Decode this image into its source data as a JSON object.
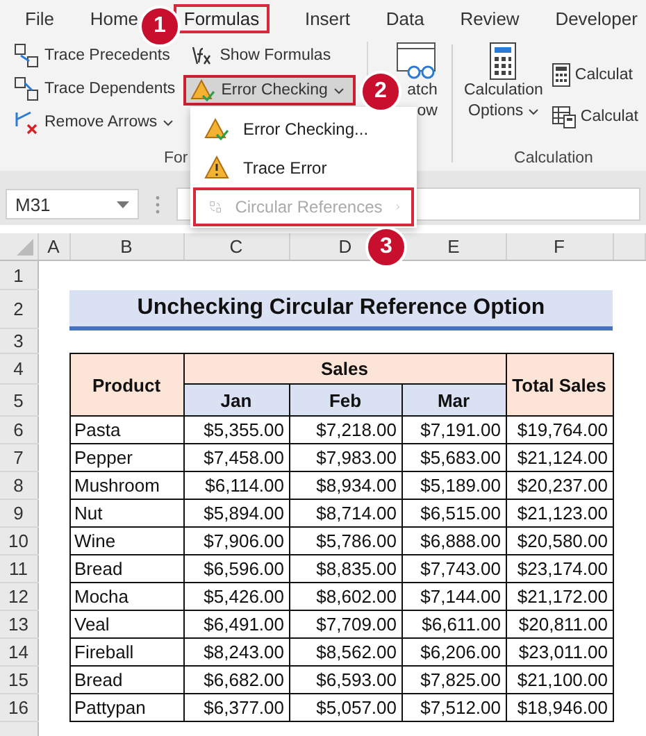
{
  "ribbon_tabs": [
    {
      "label": "File",
      "selected": false
    },
    {
      "label": "Home",
      "selected": false
    },
    {
      "label": "Formulas",
      "selected": true
    },
    {
      "label": "Insert",
      "selected": false
    },
    {
      "label": "Data",
      "selected": false
    },
    {
      "label": "Review",
      "selected": false
    },
    {
      "label": "Developer",
      "selected": false
    }
  ],
  "auditing": {
    "label": "For",
    "commands": [
      {
        "kind": "trace-precedents",
        "label": "Trace Precedents",
        "dropdown": false,
        "highlighted": false
      },
      {
        "kind": "trace-dependents",
        "label": "Trace Dependents",
        "dropdown": false,
        "highlighted": false
      },
      {
        "kind": "remove-arrows",
        "label": "Remove Arrows",
        "dropdown": true,
        "highlighted": false
      },
      {
        "kind": "show-formulas",
        "label": "Show Formulas",
        "dropdown": false,
        "highlighted": false
      },
      {
        "kind": "error-checking",
        "label": "Error Checking",
        "dropdown": true,
        "highlighted": true
      }
    ],
    "watch_lines": [
      "atch",
      "ow"
    ]
  },
  "calculation": {
    "label": "Calculation",
    "options_lines": [
      "Calculation",
      "Options"
    ],
    "commands": [
      "Calculat",
      "Calculat"
    ]
  },
  "error_menu": [
    {
      "kind": "error-checking",
      "label": "Error Checking...",
      "disabled": false,
      "highlighted": false,
      "submenu": false
    },
    {
      "kind": "trace-error",
      "label": "Trace Error",
      "disabled": false,
      "highlighted": false,
      "submenu": false
    },
    {
      "kind": "circular",
      "label": "Circular References",
      "disabled": true,
      "highlighted": true,
      "submenu": true
    }
  ],
  "callouts": [
    "1",
    "2",
    "3"
  ],
  "name_box": "M31",
  "column_headers": [
    "A",
    "B",
    "C",
    "D",
    "E",
    "F"
  ],
  "row_numbers": [
    "1",
    "2",
    "3",
    "4",
    "5",
    "6",
    "7",
    "8",
    "9",
    "10",
    "11",
    "12",
    "13",
    "14",
    "15",
    "16"
  ],
  "title": "Unchecking Circular Reference Option",
  "table": {
    "product_header": "Product",
    "sales_header": "Sales",
    "total_header": "Total Sales",
    "months": [
      "Jan",
      "Feb",
      "Mar"
    ],
    "rows": [
      [
        "Pasta",
        "$5,355.00",
        "$7,218.00",
        "$7,191.00",
        "$19,764.00"
      ],
      [
        "Pepper",
        "$7,458.00",
        "$7,983.00",
        "$5,683.00",
        "$21,124.00"
      ],
      [
        "Mushroom",
        "$6,114.00",
        "$8,934.00",
        "$5,189.00",
        "$20,237.00"
      ],
      [
        "Nut",
        "$5,894.00",
        "$8,714.00",
        "$6,515.00",
        "$21,123.00"
      ],
      [
        "Wine",
        "$7,906.00",
        "$5,786.00",
        "$6,888.00",
        "$20,580.00"
      ],
      [
        "Bread",
        "$6,596.00",
        "$8,835.00",
        "$7,743.00",
        "$23,174.00"
      ],
      [
        "Mocha",
        "$5,426.00",
        "$8,602.00",
        "$7,144.00",
        "$21,172.00"
      ],
      [
        "Veal",
        "$6,491.00",
        "$7,709.00",
        "$6,611.00",
        "$20,811.00"
      ],
      [
        "Fireball",
        "$8,243.00",
        "$8,562.00",
        "$6,206.00",
        "$23,011.00"
      ],
      [
        "Bread",
        "$6,682.00",
        "$6,593.00",
        "$7,825.00",
        "$21,100.00"
      ],
      [
        "Pattypan",
        "$6,377.00",
        "$5,057.00",
        "$7,512.00",
        "$18,946.00"
      ]
    ]
  }
}
